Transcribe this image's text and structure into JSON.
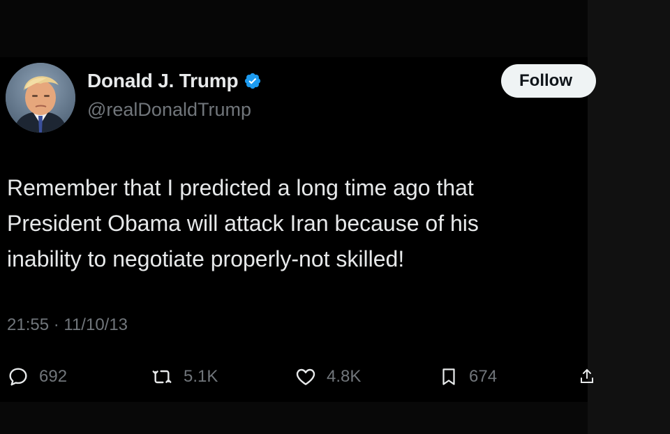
{
  "tweet": {
    "author": {
      "display_name": "Donald J. Trump",
      "handle": "@realDonaldTrump",
      "verified": true,
      "avatar_icon": "profile-photo"
    },
    "follow_label": "Follow",
    "text": "Remember that I predicted a long time ago that\nPresident Obama will attack Iran because of his\ninability to negotiate properly-not skilled!",
    "timestamp": "21:55 · 11/10/13",
    "stats": {
      "replies": "692",
      "retweets": "5.1K",
      "likes": "4.8K",
      "bookmarks": "674"
    }
  },
  "colors": {
    "background": "#000000",
    "text_primary": "#e7e9ea",
    "text_secondary": "#71767b",
    "verified_badge": "#1d9bf0",
    "follow_button_bg": "#eff3f4"
  }
}
